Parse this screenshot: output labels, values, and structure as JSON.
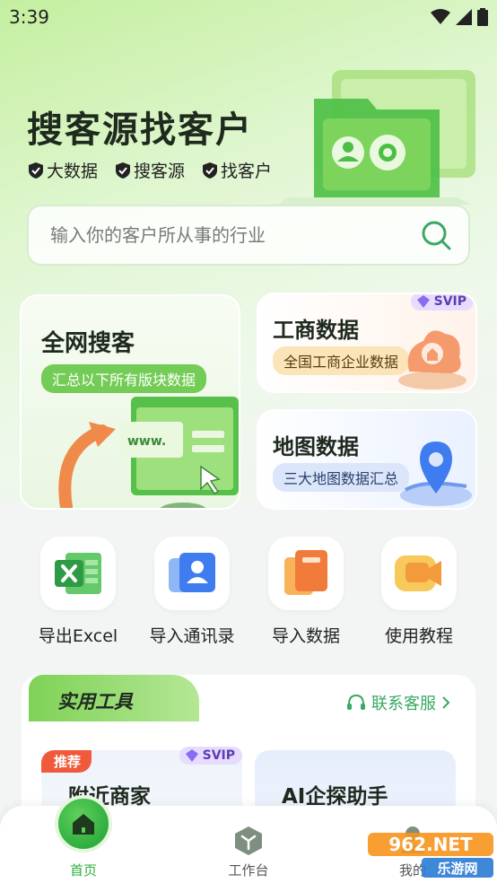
{
  "status_bar": {
    "time": "3:39"
  },
  "hero": {
    "title": "搜客源找客户",
    "tags": [
      "大数据",
      "搜客源",
      "找客户"
    ]
  },
  "search": {
    "placeholder": "输入你的客户所从事的行业"
  },
  "features": {
    "main": {
      "title": "全网搜客",
      "subtitle": "汇总以下所有版块数据",
      "illustration_text": "www."
    },
    "biz": {
      "title": "工商数据",
      "subtitle": "全国工商企业数据",
      "badge": "SVIP"
    },
    "map": {
      "title": "地图数据",
      "subtitle": "三大地图数据汇总"
    }
  },
  "quick_actions": [
    {
      "label": "导出Excel",
      "icon": "excel-icon"
    },
    {
      "label": "导入通讯录",
      "icon": "contacts-icon"
    },
    {
      "label": "导入数据",
      "icon": "import-data-icon"
    },
    {
      "label": "使用教程",
      "icon": "video-tutorial-icon"
    }
  ],
  "tools": {
    "section_title": "实用工具",
    "contact_label": "联系客服",
    "items": [
      {
        "title": "附近商家",
        "tag": "推荐",
        "badge": "SVIP"
      },
      {
        "title": "AI企探助手"
      }
    ]
  },
  "bottom_nav": {
    "items": [
      {
        "label": "首页",
        "active": true
      },
      {
        "label": "工作台"
      },
      {
        "label": "我的"
      }
    ]
  },
  "watermark": {
    "primary": "962.NET",
    "secondary": "乐游网"
  },
  "colors": {
    "accent": "#2fae3f",
    "link": "#3aa864",
    "svip": "#5c3fb0"
  }
}
